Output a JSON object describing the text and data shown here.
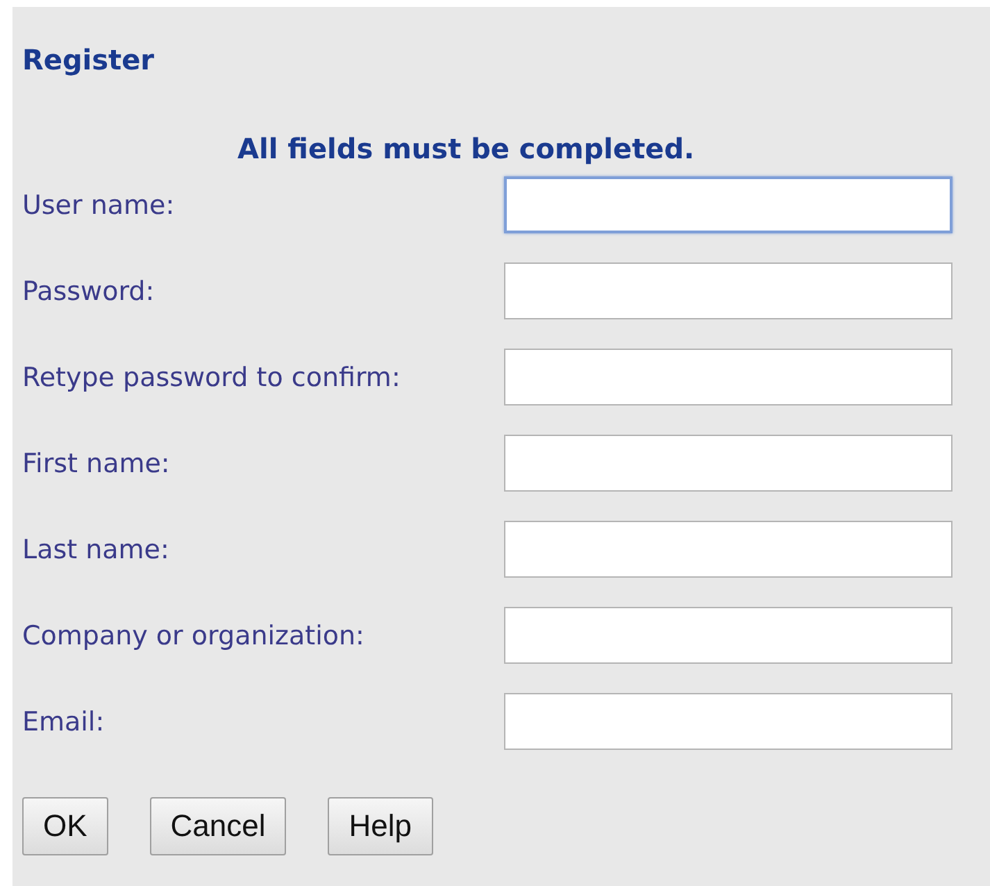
{
  "title": "Register",
  "message": "All fields must be completed.",
  "fields": [
    {
      "label": "User name:",
      "focused": true
    },
    {
      "label": "Password:",
      "focused": false
    },
    {
      "label": "Retype password to confirm:",
      "focused": false
    },
    {
      "label": "First name:",
      "focused": false
    },
    {
      "label": "Last name:",
      "focused": false
    },
    {
      "label": "Company or organization:",
      "focused": false
    },
    {
      "label": "Email:",
      "focused": false
    }
  ],
  "buttons": [
    "OK",
    "Cancel",
    "Help"
  ]
}
